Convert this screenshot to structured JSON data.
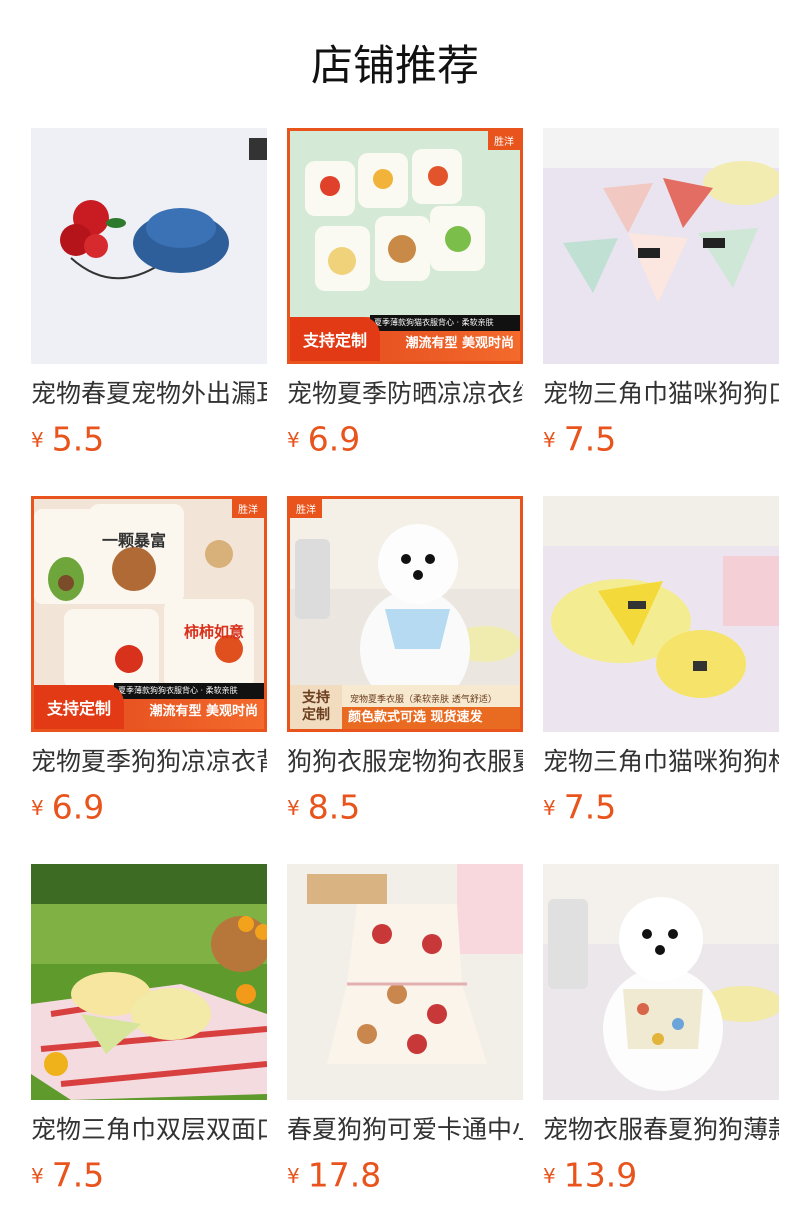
{
  "header": {
    "title": "店铺推荐"
  },
  "products": [
    {
      "name": "宠物春夏宠物外出漏耳帽",
      "currency": "¥",
      "price": "5.5",
      "thumb": "hat"
    },
    {
      "name": "宠物夏季防晒凉凉衣纯棉背心",
      "currency": "¥",
      "price": "6.9",
      "thumb": "vests-green",
      "tag": "胜洋",
      "banner_main": "支持定制",
      "banner_sub": "潮流有型 美观时尚",
      "banner_top": "夏季薄款狗猫衣服背心 · 柔软亲肤"
    },
    {
      "name": "宠物三角巾猫咪狗狗口水巾",
      "currency": "¥",
      "price": "7.5",
      "thumb": "bandanas"
    },
    {
      "name": "宠物夏季狗狗凉凉衣背心",
      "currency": "¥",
      "price": "6.9",
      "thumb": "vests-red",
      "tag": "胜洋",
      "banner_main": "支持定制",
      "banner_sub": "潮流有型 美观时尚",
      "banner_top": "夏季薄款狗狗衣服背心 · 柔软亲肤",
      "art_text_1": "一颗暴富",
      "art_text_2": "柿柿如意"
    },
    {
      "name": "狗狗衣服宠物狗衣服夏季薄款",
      "currency": "¥",
      "price": "8.5",
      "thumb": "dog-blue",
      "tag": "胜洋",
      "banner_main": "支持定制",
      "banner_sub": "颜色款式可选 现货速发",
      "banner_top": "宠物夏季衣服（柔软亲肤 透气舒适）"
    },
    {
      "name": "宠物三角巾猫咪狗狗格子口水巾",
      "currency": "¥",
      "price": "7.5",
      "thumb": "yellow-check"
    },
    {
      "name": "宠物三角巾双层双面口水巾",
      "currency": "¥",
      "price": "7.5",
      "thumb": "picnic"
    },
    {
      "name": "春夏狗狗可爱卡通中小型犬裙子",
      "currency": "¥",
      "price": "17.8",
      "thumb": "bear-dress"
    },
    {
      "name": "宠物衣服春夏狗狗薄款衬衫",
      "currency": "¥",
      "price": "13.9",
      "thumb": "dog-shirt"
    }
  ],
  "colors": {
    "price": "#e8541c",
    "accent": "#e23a15"
  }
}
